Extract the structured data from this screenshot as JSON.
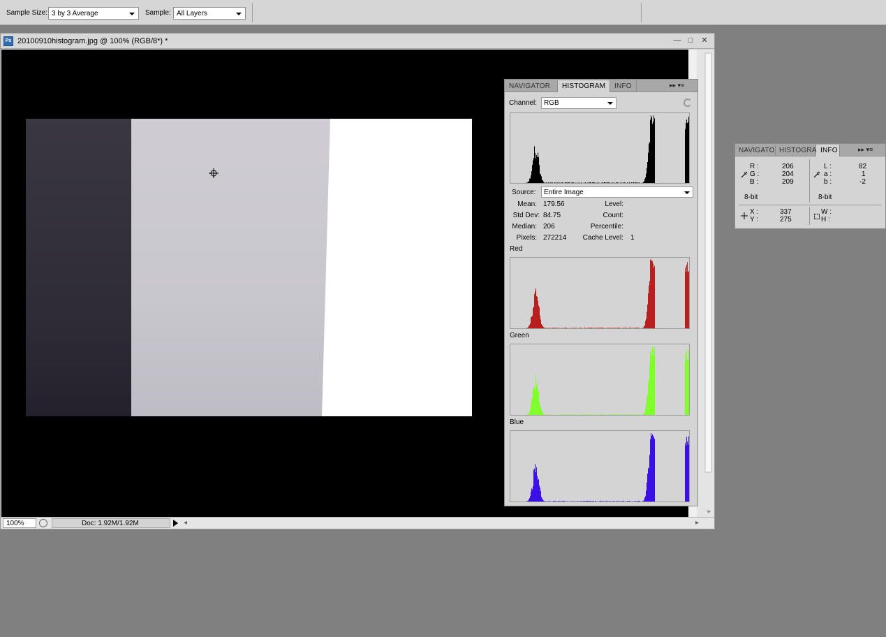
{
  "options_bar": {
    "sample_size_label": "Sample Size:",
    "sample_size_value": "3 by 3 Average",
    "sample_label": "Sample:",
    "sample_value": "All Layers"
  },
  "document": {
    "app_icon": "Ps",
    "title": "20100910histogram.jpg @ 100% (RGB/8*) *",
    "minimize_glyph": "—",
    "maximize_glyph": "□",
    "close_glyph": "✕",
    "zoom": "100%",
    "doc_info": "Doc: 1.92M/1.92M",
    "icons": {
      "status": "status-clock-icon",
      "crosshair": "eyedropper-crosshair-icon",
      "menu_arrow": "triangle-right-icon"
    }
  },
  "histogram_panel": {
    "tabs": [
      "NAVIGATOR",
      "HISTOGRAM",
      "INFO"
    ],
    "active_tab": "HISTOGRAM",
    "menu_glyph": "▸▸ ▾≡",
    "channel_label": "Channel:",
    "channel_value": "RGB",
    "source_label": "Source:",
    "source_value": "Entire Image",
    "stats": {
      "mean_label": "Mean:",
      "mean": "179.56",
      "std_label": "Std Dev:",
      "std": "84.75",
      "median_label": "Median:",
      "median": "206",
      "pixels_label": "Pixels:",
      "pixels": "272214",
      "level_label": "Level:",
      "count_label": "Count:",
      "percentile_label": "Percentile:",
      "cache_label": "Cache Level:",
      "cache": "1"
    },
    "channels": [
      {
        "name": "Red",
        "color": "#b7201f"
      },
      {
        "name": "Green",
        "color": "#80ff2a"
      },
      {
        "name": "Blue",
        "color": "#3a10e6"
      }
    ],
    "composite_color": "#000000"
  },
  "info_panel": {
    "tabs": [
      "NAVIGATO",
      "HISTOGRA",
      "INFO"
    ],
    "active_tab": "INFO",
    "menu_glyph": "▸▸ ▾≡",
    "rgb": {
      "r_label": "R :",
      "r": "206",
      "g_label": "G :",
      "g": "204",
      "b_label": "B :",
      "b": "209",
      "depth": "8-bit"
    },
    "lab": {
      "l_label": "L :",
      "l": "82",
      "a_label": "a :",
      "a": "1",
      "b_label": "b :",
      "b": "-2",
      "depth": "8-bit"
    },
    "position": {
      "x_label": "X :",
      "x": "337",
      "y_label": "Y :",
      "y": "275"
    },
    "size": {
      "w_label": "W :",
      "h_label": "H :"
    }
  }
}
